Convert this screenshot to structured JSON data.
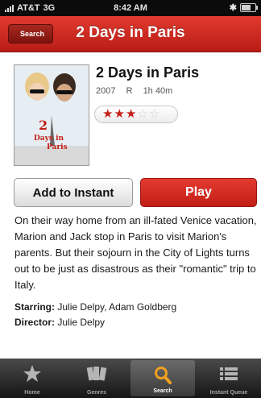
{
  "status_bar": {
    "carrier": "AT&T",
    "network": "3G",
    "time": "8:42 AM"
  },
  "nav": {
    "back_label": "Search",
    "title": "2 Days in Paris"
  },
  "movie": {
    "title": "2 Days in Paris",
    "year": "2007",
    "rating": "R",
    "runtime": "1h 40m",
    "stars": 3,
    "stars_max": 5,
    "poster_text": "2 Days in Paris"
  },
  "actions": {
    "add_label": "Add to Instant",
    "play_label": "Play"
  },
  "synopsis": "On their way home from an ill-fated Venice vacation, Marion and Jack stop in Paris to visit Marion's parents. But their sojourn in the City of Lights turns out to be just as disastrous as their \"romantic\" trip to Italy.",
  "credits": {
    "starring_label": "Starring:",
    "starring": "Julie Delpy, Adam Goldberg",
    "director_label": "Director:",
    "director": "Julie Delpy"
  },
  "tabs": [
    {
      "label": "Home",
      "icon": "star-icon"
    },
    {
      "label": "Genres",
      "icon": "genres-icon"
    },
    {
      "label": "Search",
      "icon": "search-icon",
      "active": true
    },
    {
      "label": "Instant Queue",
      "icon": "list-icon"
    }
  ],
  "colors": {
    "accent": "#c21f17",
    "tab_bar": "#1c1c1c"
  }
}
